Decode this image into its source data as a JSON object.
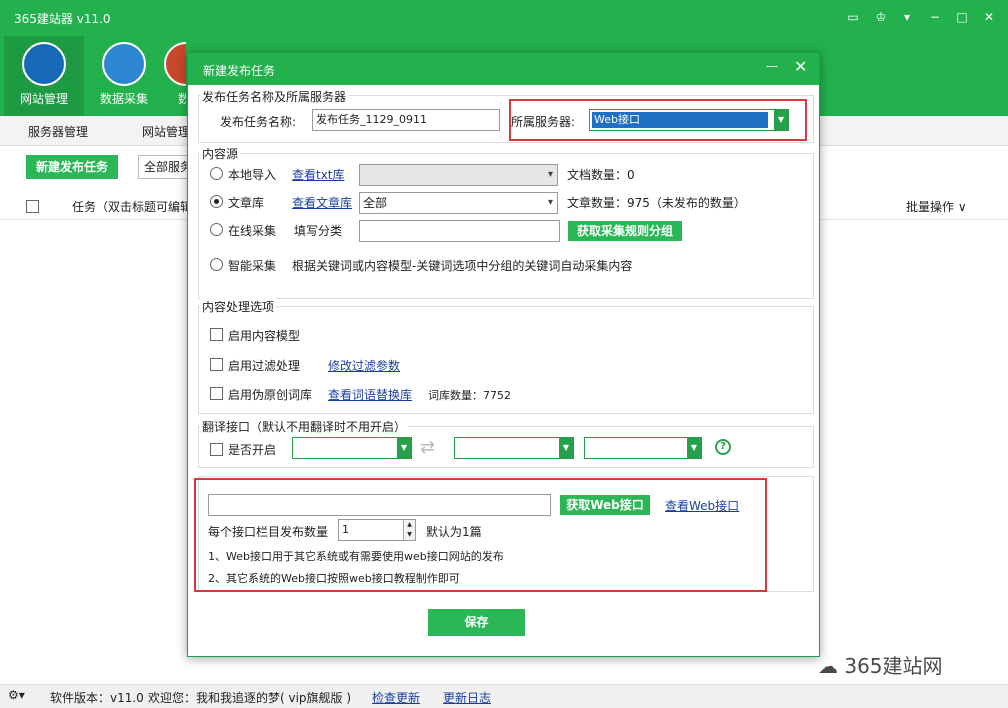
{
  "app": {
    "title": "365建站器 v11.0",
    "toolbar": [
      {
        "label": "网站管理",
        "icon": "monitor-icon",
        "color": "#1769b8"
      },
      {
        "label": "数据采集",
        "icon": "globe-icon",
        "color": "#2e86d0"
      },
      {
        "label": "数",
        "icon": "data-icon",
        "color": "#c9472b"
      }
    ],
    "subtabs": [
      "服务器管理",
      "网站管理"
    ],
    "new_task_button": "新建发布任务",
    "server_filter": "全部服务",
    "task_header": "任务（双击标题可编辑",
    "batch_ops": "批量操作",
    "status": {
      "version": "软件版本：v11.0",
      "welcome": "欢迎您：我和我追逐的梦( vip旗舰版 )",
      "check_update": "检查更新",
      "changelog": "更新日志"
    },
    "watermark": "365建站网"
  },
  "dialog": {
    "title": "新建发布任务",
    "section_name": {
      "legend": "发布任务名称及所属服务器",
      "task_name_label": "发布任务名称:",
      "task_name_value": "发布任务_1129_0911",
      "server_label": "所属服务器:",
      "server_value": "Web接口"
    },
    "section_source": {
      "legend": "内容源",
      "local_import": "本地导入",
      "view_txt": "查看txt库",
      "doc_count": "文档数量：0",
      "article_lib": "文章库",
      "view_article": "查看文章库",
      "article_select": "全部",
      "article_count": "文章数量：975（未发布的数量）",
      "online_collect": "在线采集",
      "fill_category": "填写分类",
      "get_rule_group": "获取采集规则分组",
      "smart_collect": "智能采集",
      "smart_desc": "根据关键词或内容模型-关键词选项中分组的关键词自动采集内容"
    },
    "section_process": {
      "legend": "内容处理选项",
      "enable_model": "启用内容模型",
      "enable_filter": "启用过滤处理",
      "edit_filter": "修改过滤参数",
      "enable_pseudo": "启用伪原创词库",
      "view_synonym": "查看词语替换库",
      "lexicon_count": "词库数量：7752"
    },
    "section_translate": {
      "legend": "翻译接口（默认不用翻译时不用开启）",
      "enable": "是否开启"
    },
    "section_web": {
      "url_value": "",
      "get_web_api": "获取Web接口",
      "view_web_api": "查看Web接口",
      "per_column_label": "每个接口栏目发布数量",
      "per_column_value": "1",
      "default_note": "默认为1篇",
      "note1": "1、Web接口用于其它系统或有需要使用web接口网站的发布",
      "note2": "2、其它系统的Web接口按照web接口教程制作即可"
    },
    "save_button": "保存"
  }
}
